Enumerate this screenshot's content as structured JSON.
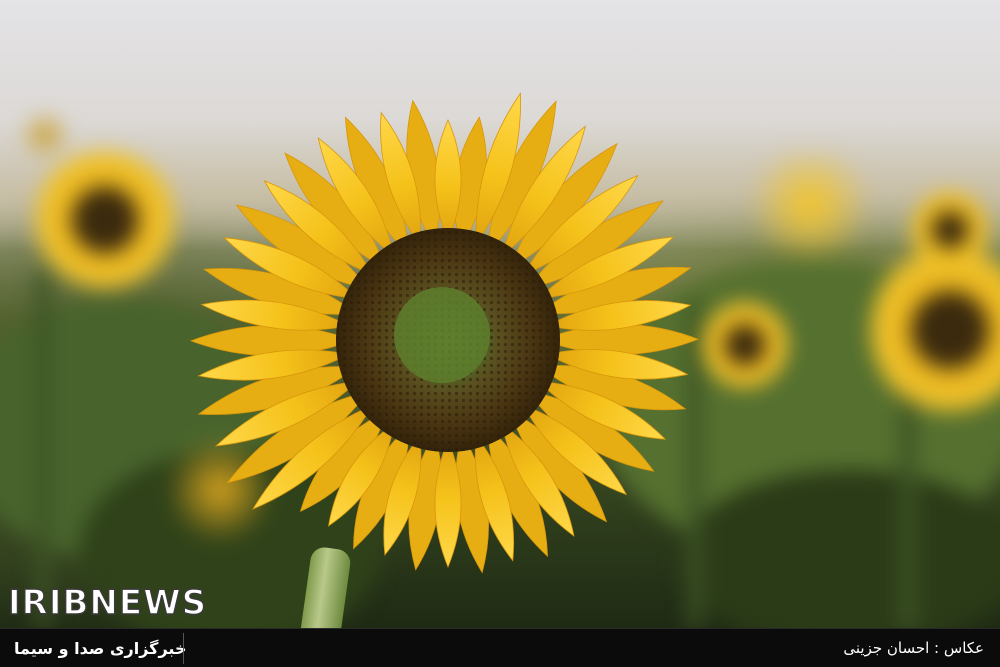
{
  "watermark": {
    "logo_text": "IRIBNEWS"
  },
  "footer": {
    "agency_name": "خبرگزاری صدا و سیما",
    "photo_credit": "عکاس : احسان جزینی"
  },
  "colors": {
    "sky": "#e4e3e6",
    "petal": "#f5c21a",
    "petal_shadow": "#e0a20f",
    "disk_outer": "#4a3512",
    "disk_center": "#5f7a2c",
    "footer_bg": "#0b0b0b"
  },
  "scene": {
    "subject": "sunflower-icon",
    "background": "sunflower-field"
  }
}
